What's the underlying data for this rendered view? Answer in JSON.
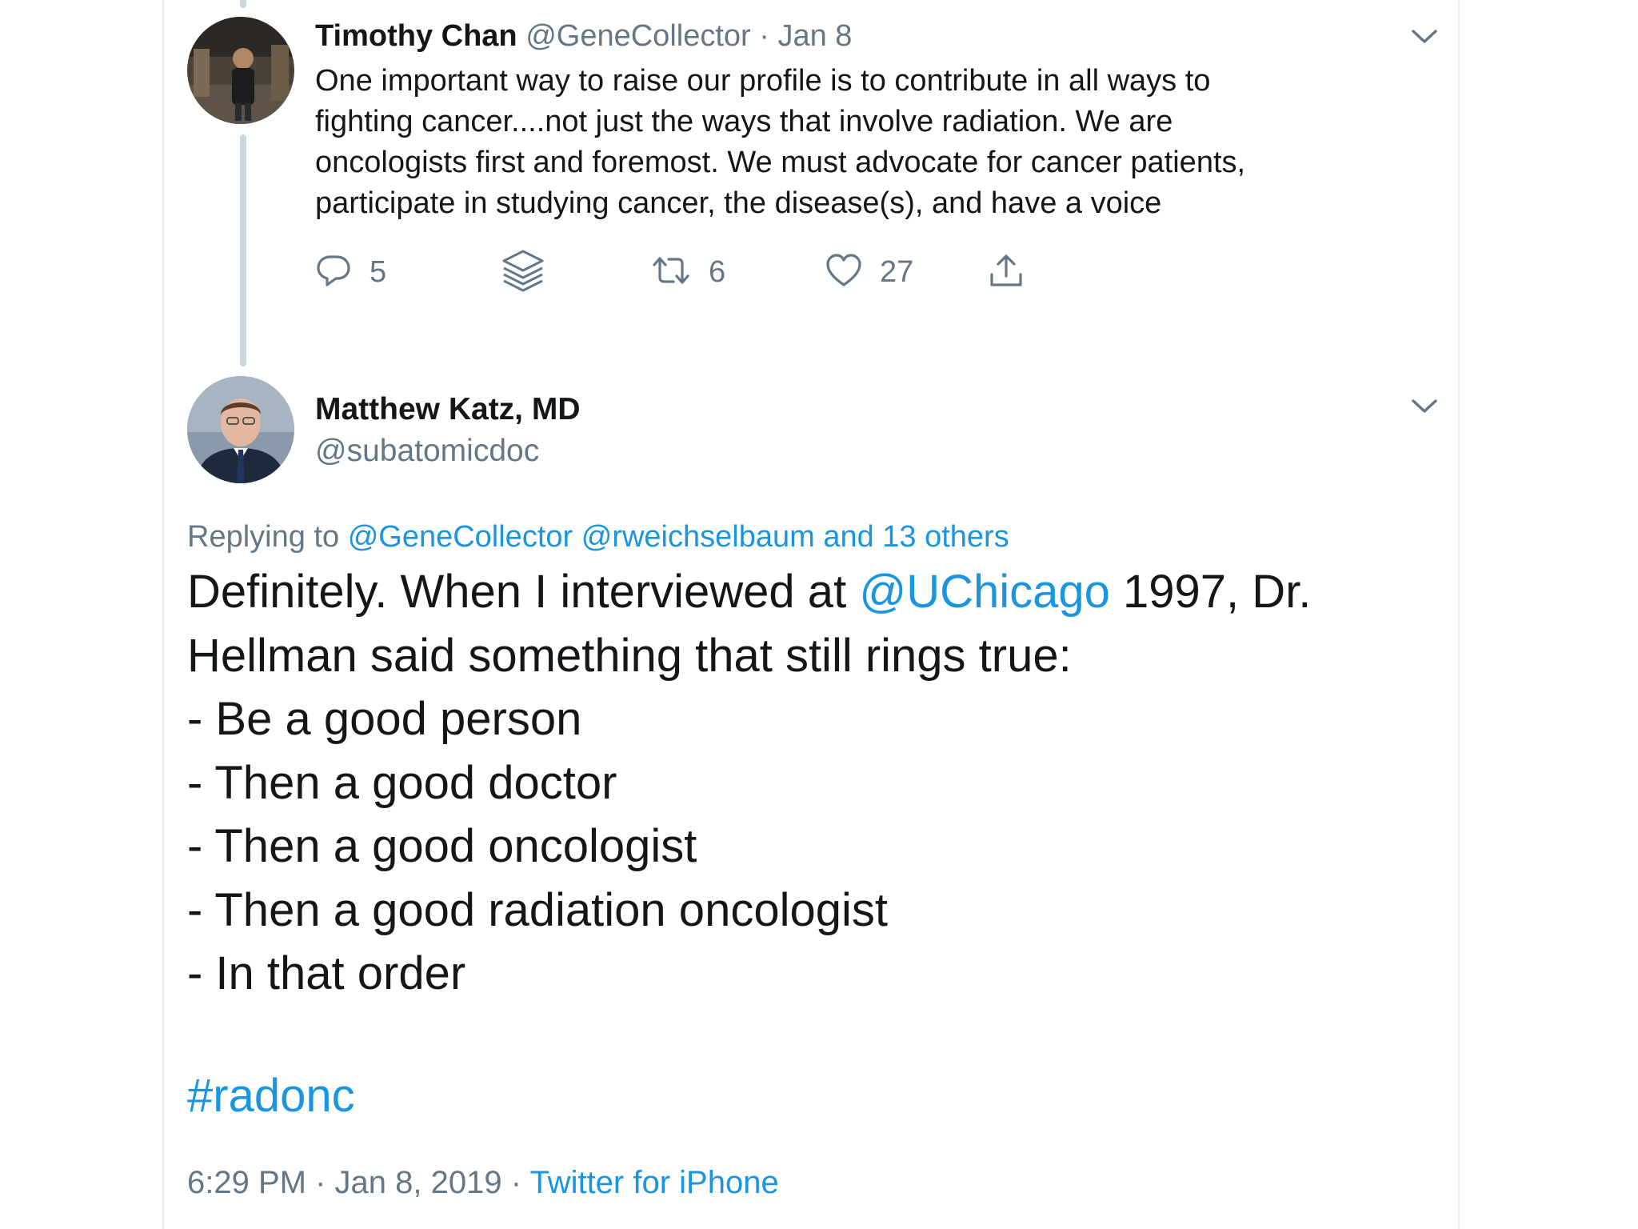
{
  "colors": {
    "link": "#1b95e0",
    "muted_text": "#657786",
    "primary_text": "#14171a",
    "thread_line": "#ccd6dd"
  },
  "tweet1": {
    "name": "Timothy Chan",
    "handle": "@GeneCollector",
    "separator": "·",
    "date": "Jan 8",
    "avatar_icon": "person-photo-avatar",
    "menu_icon": "chevron-down-icon",
    "text_lines": [
      "One important way to raise our profile is to contribute in all ways to",
      "fighting cancer....not just the ways that involve radiation.  We are",
      "oncologists first and foremost.  We must advocate for cancer patients,",
      "participate in studying cancer, the disease(s), and have a voice"
    ],
    "actions": {
      "reply": {
        "icon": "reply-icon",
        "count": "5"
      },
      "stack": {
        "icon": "layers-icon"
      },
      "retweet": {
        "icon": "retweet-icon",
        "count": "6"
      },
      "like": {
        "icon": "heart-icon",
        "count": "27"
      },
      "share": {
        "icon": "share-icon"
      }
    }
  },
  "tweet2": {
    "name": "Matthew Katz, MD",
    "handle": "@subatomicdoc",
    "avatar_icon": "person-photo-avatar",
    "menu_icon": "chevron-down-icon",
    "replying_prefix": "Replying to",
    "replying_to": [
      "@GeneCollector",
      "@rweichselbaum",
      "and 13 others"
    ],
    "text_line1_before": "Definitely. When I interviewed at",
    "text_line1_mention": "@UChicago",
    "text_line1_after": "1997, Dr.",
    "text_lines": [
      "Hellman said something that still rings true:",
      "- Be a good person",
      "- Then a good doctor",
      "- Then a good oncologist",
      "- Then a good radiation oncologist",
      "- In that order"
    ],
    "hashtag": "#radonc",
    "time": "6:29 PM",
    "date": "Jan 8, 2019",
    "separator": "·",
    "source": "Twitter for iPhone"
  }
}
